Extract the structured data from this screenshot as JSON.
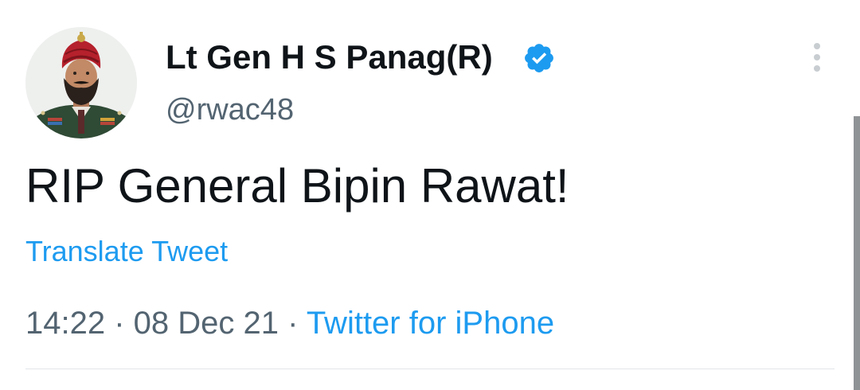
{
  "author": {
    "display_name": "Lt Gen H S Panag(R)",
    "handle": "@rwac48",
    "avatar_icon": "avatar-photo",
    "verified_icon": "verified-badge-icon"
  },
  "tweet": {
    "text": "RIP General Bipin Rawat!",
    "translate_label": "Translate Tweet"
  },
  "meta": {
    "time": "14:22",
    "separator": " · ",
    "date": "08 Dec 21",
    "source": "Twitter for iPhone"
  },
  "colors": {
    "accent": "#1d9bf0",
    "text_primary": "#0f1419",
    "text_secondary": "#536471",
    "divider": "#e1e6e9"
  }
}
